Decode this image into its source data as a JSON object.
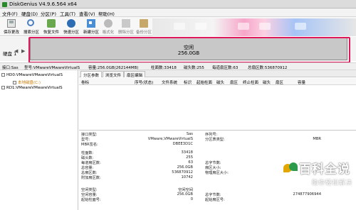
{
  "window": {
    "title": "DiskGenius V4.9.6.564 x64"
  },
  "menu": [
    "文件(F)",
    "硬盘(D)",
    "分区(P)",
    "工具(T)",
    "查看(V)",
    "帮助(H)"
  ],
  "toolbar": [
    {
      "label": "保存更改",
      "icon": "save-icon"
    },
    {
      "label": "搜索分区",
      "icon": "search-icon"
    },
    {
      "label": "恢复文件",
      "icon": "restore-icon"
    },
    {
      "label": "快速分区",
      "icon": "quick-partition-icon"
    },
    {
      "label": "新建分区",
      "icon": "new-partition-icon"
    },
    {
      "label": "格式化",
      "icon": "format-icon"
    },
    {
      "label": "删除分区",
      "icon": "delete-icon"
    },
    {
      "label": "备份分区",
      "icon": "backup-icon"
    }
  ],
  "disk": {
    "label": "硬盘 1",
    "bar_title": "空闲",
    "bar_size": "256.0GB"
  },
  "info_line": {
    "iface": "接口:Sas",
    "model": "型号:VMwareVMwareVirtualS",
    "capacity": "容量:256.0GB(262144MB)",
    "cylinders": "柱面数:33418",
    "heads": "磁头数:255",
    "sectors_per_track": "每道扇区数:63",
    "total_sectors": "总扇区数:536870912"
  },
  "tree": {
    "disk0": "HD0:VMwareVMwareVirtualS",
    "partition": "本地磁盘(C:)",
    "disk1": "RD1:VMwareVMwareVirtualS"
  },
  "tabs": [
    "分区参数",
    "浏览文件",
    "扇区编辑"
  ],
  "table_headers": [
    "卷标",
    "序号(状态)",
    "文件系统",
    "标识",
    "起始柱面",
    "磁头",
    "扇区",
    "终止柱面",
    "磁头",
    "扇区",
    "容量"
  ],
  "details": {
    "left": [
      {
        "k": "接口类型:",
        "v": "Sas"
      },
      {
        "k": "型号:",
        "v": "VMware,VMwareVirtualS"
      },
      {
        "k": "MBR签名:",
        "v": "DBEE3D1C"
      },
      {
        "k": "柱面数:",
        "v": "33418"
      },
      {
        "k": "磁头数:",
        "v": "255"
      },
      {
        "k": "每道扇区数:",
        "v": "63"
      },
      {
        "k": "总容量:",
        "v": "256.0GB"
      },
      {
        "k": "总扇区数:",
        "v": "536870912"
      },
      {
        "k": "附加扇区数:",
        "v": "10742"
      }
    ],
    "right": [
      {
        "k": "序列号:",
        "v": ""
      },
      {
        "k": "分区表类型:",
        "v": "MBR"
      },
      {
        "k": "总字节数:",
        "v": ""
      },
      {
        "k": "扇区大小:",
        "v": ""
      },
      {
        "k": "物理扇区大小:",
        "v": ""
      }
    ],
    "free": [
      {
        "k": "空闲类型:",
        "v": "空闲空间"
      },
      {
        "k": "空闲容量:",
        "v": "256.0GB"
      },
      {
        "k": "起始柱面号:",
        "v": "0"
      }
    ],
    "free_right": [
      {
        "k": "总字节数:",
        "v": "274877906944"
      },
      {
        "k": "起始扇区号:",
        "v": ""
      }
    ]
  },
  "watermark": {
    "title": "百科全说",
    "subtitle": "助你轻松解决"
  }
}
